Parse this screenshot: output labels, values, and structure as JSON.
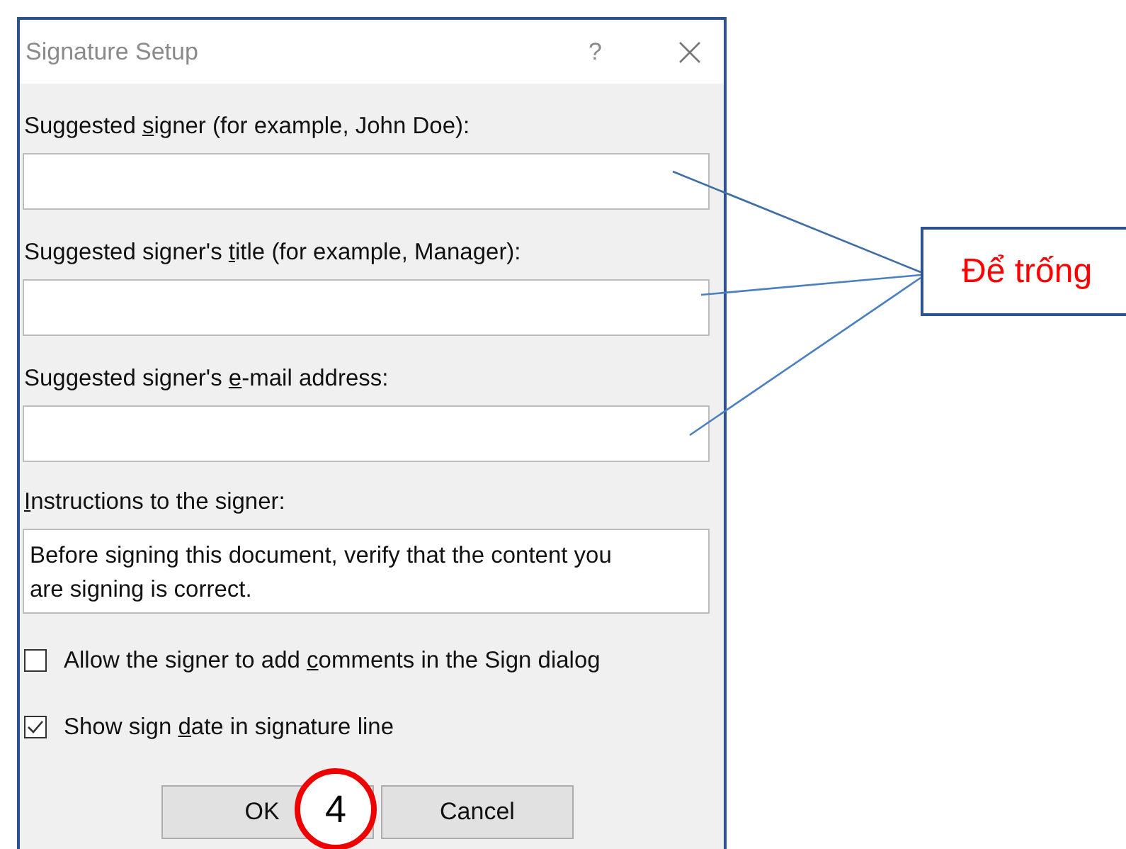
{
  "window": {
    "title": "Signature Setup",
    "help": "?"
  },
  "fields": [
    {
      "kind": "single",
      "label": {
        "before": "Suggested ",
        "key": "s",
        "after": "igner (for example, John Doe):"
      }
    },
    {
      "kind": "single",
      "label": {
        "before": "Suggested signer's ",
        "key": "t",
        "after": "itle (for example, Manager):"
      }
    },
    {
      "kind": "single",
      "label": {
        "before": "Suggested signer's ",
        "key": "e",
        "after": "-mail address:"
      }
    },
    {
      "kind": "multiline",
      "label": {
        "key": "I",
        "after": "nstructions to the signer:"
      },
      "value": "Before signing this document, verify that the content you are signing is correct."
    }
  ],
  "checkboxes": [
    {
      "label": {
        "before": "Allow the signer to add ",
        "key": "c",
        "after": "omments in the Sign dialog"
      },
      "checked": false
    },
    {
      "label": {
        "before": "Show sign ",
        "key": "d",
        "after": "ate in signature line"
      },
      "checked": true
    }
  ],
  "buttons": [
    "OK",
    "Cancel"
  ],
  "annotations": {
    "callout": "Để trống",
    "step": "4"
  }
}
